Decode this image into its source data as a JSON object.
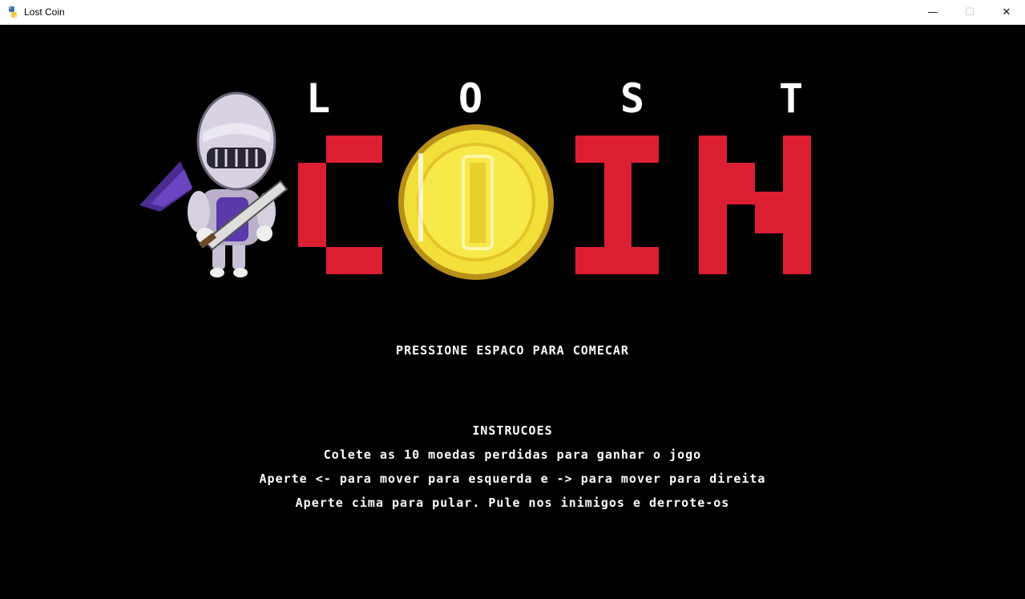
{
  "window": {
    "title": "Lost Coin",
    "controls": {
      "minimize": "—",
      "maximize": "☐",
      "close": "✕"
    }
  },
  "logo": {
    "top_letters": [
      "L",
      "O",
      "S",
      "T"
    ],
    "bottom_word": "COIN",
    "letter_color": "#dc1e32",
    "coin_color": "#f2df3a"
  },
  "prompt": "PRESSIONE ESPACO PARA COMECAR",
  "instructions": {
    "heading": "INSTRUCOES",
    "lines": [
      "Colete as 10 moedas perdidas para ganhar o jogo",
      "Aperte <- para mover para esquerda e -> para mover para direita",
      "Aperte cima para pular. Pule nos inimigos e derrote-os"
    ]
  }
}
